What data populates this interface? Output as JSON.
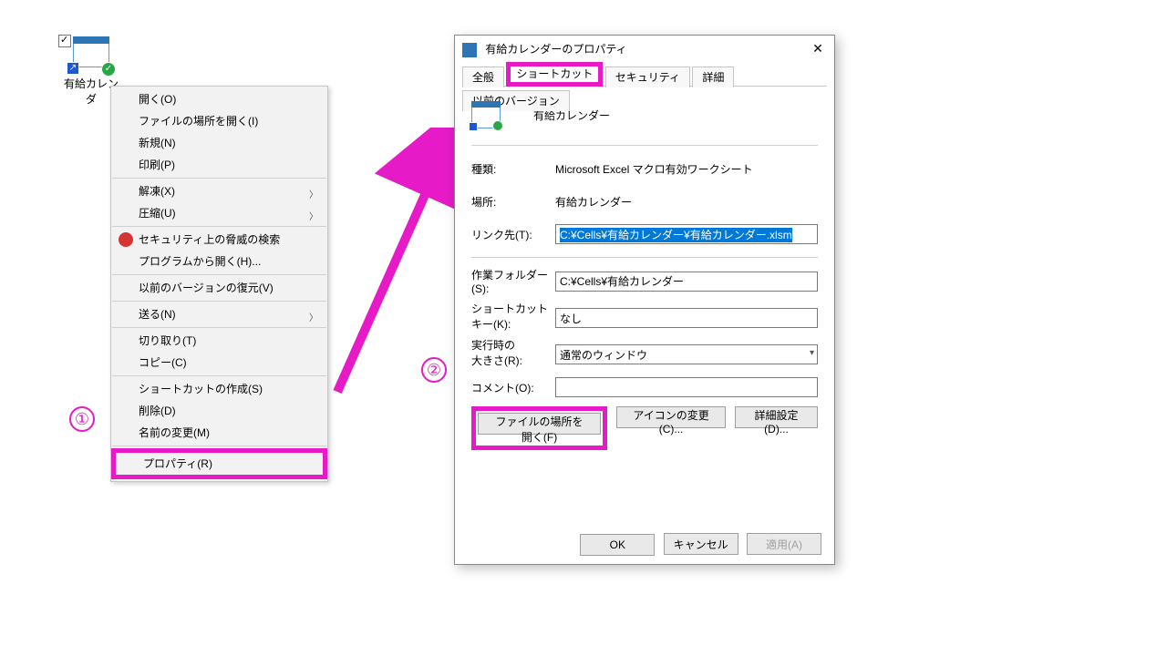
{
  "desktop": {
    "icon_label": "有給カレンダ"
  },
  "context_menu": {
    "open": "開く(O)",
    "open_location": "ファイルの場所を開く(I)",
    "new": "新規(N)",
    "print": "印刷(P)",
    "thaw": "解凍(X)",
    "compress": "圧縮(U)",
    "security_scan": "セキュリティ上の脅威の検索",
    "open_with": "プログラムから開く(H)...",
    "restore_prev": "以前のバージョンの復元(V)",
    "send_to": "送る(N)",
    "cut": "切り取り(T)",
    "copy": "コピー(C)",
    "create_shortcut": "ショートカットの作成(S)",
    "delete": "削除(D)",
    "rename": "名前の変更(M)",
    "properties": "プロパティ(R)"
  },
  "dialog": {
    "title": "有給カレンダーのプロパティ",
    "tabs": {
      "general": "全般",
      "shortcut": "ショートカット",
      "security": "セキュリティ",
      "details": "詳細",
      "prev": "以前のバージョン"
    },
    "name_value": "有給カレンダー",
    "type_label": "種類:",
    "type_value": "Microsoft Excel マクロ有効ワークシート",
    "location_label": "場所:",
    "location_value": "有給カレンダー",
    "target_label": "リンク先(T):",
    "target_value": "C:¥Cells¥有給カレンダー¥有給カレンダー.xlsm",
    "workdir_label": "作業フォルダー(S):",
    "workdir_value": "C:¥Cells¥有給カレンダー",
    "sckey_label_a": "ショートカット",
    "sckey_label_b": "キー(K):",
    "sckey_value": "なし",
    "runsize_label_a": "実行時の",
    "runsize_label_b": "大きさ(R):",
    "runsize_value": "通常のウィンドウ",
    "comment_label": "コメント(O):",
    "comment_value": "",
    "btn_open_loc": "ファイルの場所を開く(F)",
    "btn_change_icon": "アイコンの変更(C)...",
    "btn_advanced": "詳細設定(D)...",
    "btn_ok": "OK",
    "btn_cancel": "キャンセル",
    "btn_apply": "適用(A)"
  },
  "annotation": {
    "num1": "①",
    "num2": "②"
  }
}
